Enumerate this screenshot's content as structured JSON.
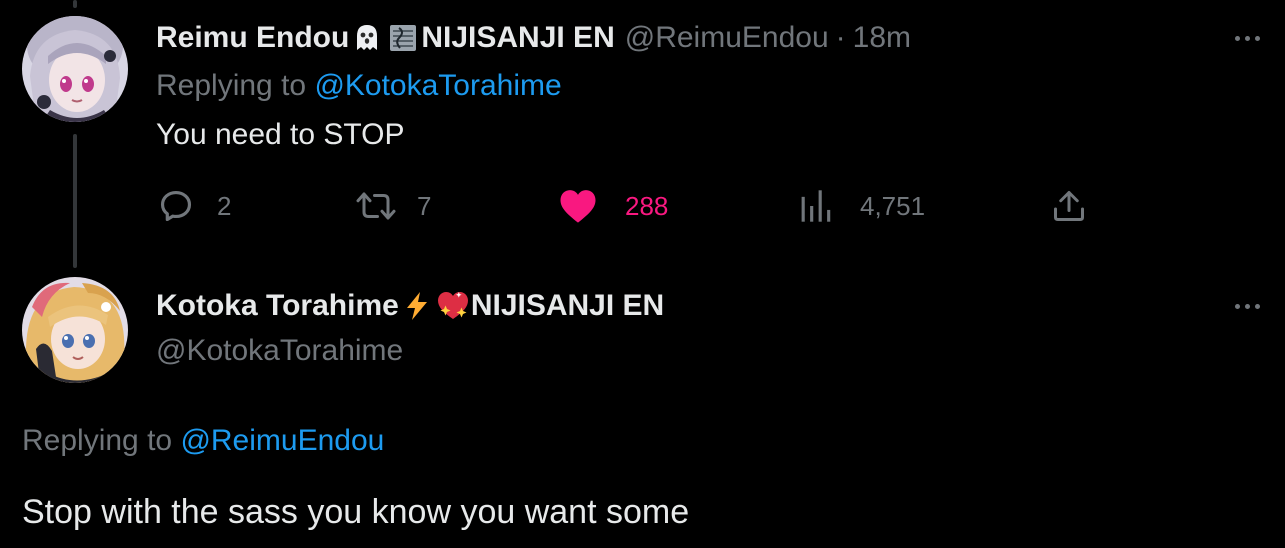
{
  "reply_tweet": {
    "display_name": "Reimu Endou",
    "name_suffix": "NIJISANJI EN",
    "emoji_1": "ghost-emoji",
    "emoji_2": "music-score-emoji",
    "handle": "@ReimuEndou",
    "separator": "·",
    "time": "18m",
    "replying_prefix": "Replying to ",
    "replying_to": "@KotokaTorahime",
    "text": "You need to STOP",
    "replies": "2",
    "retweets": "7",
    "likes": "288",
    "views": "4,751",
    "liked": true
  },
  "main_tweet": {
    "display_name": "Kotoka Torahime",
    "emoji_1": "high-voltage-emoji",
    "emoji_2": "sparkling-heart-emoji",
    "name_suffix": "NIJISANJI EN",
    "handle": "@KotokaTorahime",
    "replying_prefix": "Replying to ",
    "replying_to": "@ReimuEndou",
    "text": "Stop with the sass you know you want some"
  },
  "colors": {
    "background": "#000000",
    "text": "#e7e9ea",
    "muted": "#71767b",
    "link": "#1d9bf0",
    "like": "#f91880"
  }
}
